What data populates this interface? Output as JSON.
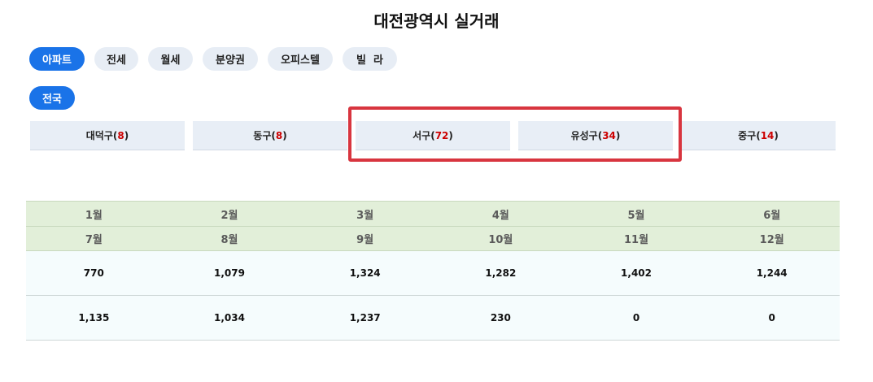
{
  "title": "대전광역시 실거래",
  "property_types": [
    {
      "label": "아파트",
      "active": true
    },
    {
      "label": "전세",
      "active": false
    },
    {
      "label": "월세",
      "active": false
    },
    {
      "label": "분양권",
      "active": false
    },
    {
      "label": "오피스텔",
      "active": false
    },
    {
      "label": "빌  라",
      "active": false
    }
  ],
  "region_filter": {
    "label": "전국",
    "active": true
  },
  "districts": [
    {
      "name": "대덕구",
      "count": "8"
    },
    {
      "name": "동구",
      "count": "8"
    },
    {
      "name": "서구",
      "count": "72"
    },
    {
      "name": "유성구",
      "count": "34"
    },
    {
      "name": "중구",
      "count": "14"
    }
  ],
  "months_row1": [
    "1월",
    "2월",
    "3월",
    "4월",
    "5월",
    "6월"
  ],
  "months_row2": [
    "7월",
    "8월",
    "9월",
    "10월",
    "11월",
    "12월"
  ],
  "values_row1": [
    "770",
    "1,079",
    "1,324",
    "1,282",
    "1,402",
    "1,244"
  ],
  "values_row2": [
    "1,135",
    "1,034",
    "1,237",
    "230",
    "0",
    "0"
  ],
  "colors": {
    "active_pill": "#1a73e8",
    "highlight_border": "#d8353f",
    "count_text": "#cc0000",
    "month_header_bg": "#e2efd9"
  }
}
